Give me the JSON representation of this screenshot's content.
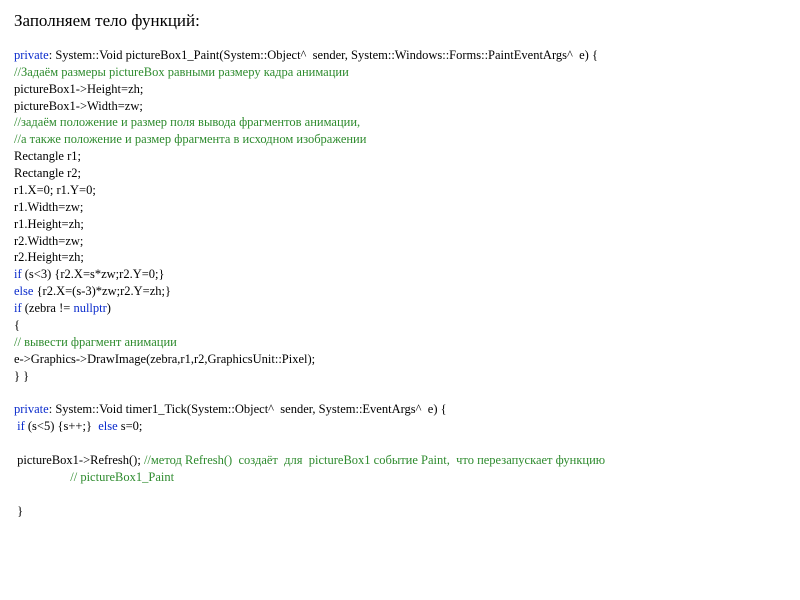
{
  "title": "Заполняем тело функций:",
  "code": {
    "l01a": "private",
    "l01b": ": System::Void pictureBox1_Paint(System::Object^  sender, System::Windows::Forms::PaintEventArgs^  e) {",
    "l02": "//Задаём размеры pictureBox равными размеру кадра анимации",
    "l03": "pictureBox1->Height=zh;",
    "l04": "pictureBox1->Width=zw;",
    "l05": "//задаём положение и размер поля вывода фрагментов анимации,",
    "l06": "//а также положение и размер фрагмента в исходном изображении",
    "l07": "Rectangle r1;",
    "l08": "Rectangle r2;",
    "l09": "r1.X=0; r1.Y=0;",
    "l10": "r1.Width=zw;",
    "l11": "r1.Height=zh;",
    "l12": "r2.Width=zw;",
    "l13": "r2.Height=zh;",
    "l14a": "if",
    "l14b": " (s<3) {r2.X=s*zw;r2.Y=0;}",
    "l15a": "else",
    "l15b": " {r2.X=(s-3)*zw;r2.Y=zh;}",
    "l16a": "if",
    "l16b": " (zebra != ",
    "l16c": "nullptr",
    "l16d": ")",
    "l17": "{",
    "l18": "// вывести фрагмент анимации",
    "l19": "e->Graphics->DrawImage(zebra,r1,r2,GraphicsUnit::Pixel);",
    "l20": "} }",
    "l22a": "private",
    "l22b": ": System::Void timer1_Tick(System::Object^  sender, System::EventArgs^  e) {",
    "l23a": " if",
    "l23b": " (s<5) {s++;}  ",
    "l23c": "else",
    "l23d": " s=0;",
    "l25a": " pictureBox1->Refresh(); ",
    "l25b": "//метод Refresh()  создаёт  для  pictureBox1 событие Paint,  что перезапускает функцию",
    "l26": "                  // pictureBox1_Paint",
    "l28": " }"
  }
}
